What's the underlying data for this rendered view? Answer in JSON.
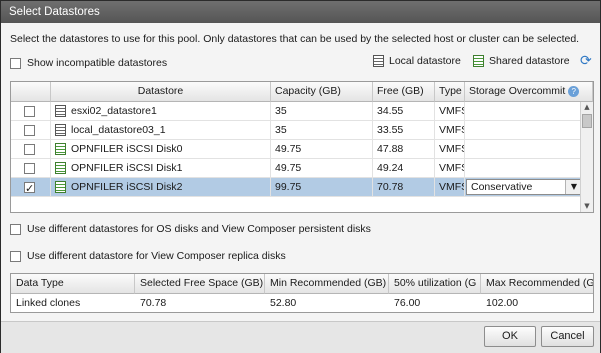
{
  "dialog": {
    "title": "Select Datastores",
    "instructions": "Select the datastores to use for this pool. Only datastores that can be used by the selected host or cluster can be selected.",
    "show_incompatible_label": "Show incompatible datastores",
    "show_incompatible_checked": false,
    "legend_local": "Local datastore",
    "legend_shared": "Shared datastore"
  },
  "grid": {
    "headers": [
      "Datastore",
      "Capacity (GB)",
      "Free (GB)",
      "Type",
      "Storage Overcommit"
    ],
    "rows": [
      {
        "checked": false,
        "icon": "local-datastore-icon",
        "name": "esxi02_datastore1",
        "capacity": "35",
        "free": "34.55",
        "type": "VMFS",
        "overcommit": ""
      },
      {
        "checked": false,
        "icon": "local-datastore-icon",
        "name": "local_datastore03_1",
        "capacity": "35",
        "free": "33.55",
        "type": "VMFS",
        "overcommit": ""
      },
      {
        "checked": false,
        "icon": "shared-datastore-icon",
        "name": "OPNFILER iSCSI Disk0",
        "capacity": "49.75",
        "free": "47.88",
        "type": "VMFS",
        "overcommit": ""
      },
      {
        "checked": false,
        "icon": "shared-datastore-icon",
        "name": "OPNFILER iSCSI Disk1",
        "capacity": "49.75",
        "free": "49.24",
        "type": "VMFS",
        "overcommit": ""
      },
      {
        "checked": true,
        "icon": "shared-datastore-icon",
        "name": "OPNFILER iSCSI Disk2",
        "capacity": "99.75",
        "free": "70.78",
        "type": "VMFS",
        "overcommit": "Conservative"
      }
    ]
  },
  "options": {
    "separate_os_label": "Use different datastores for OS disks and View Composer persistent disks",
    "separate_replica_label": "Use different datastore for View Composer replica disks"
  },
  "summary": {
    "headers": [
      "Data Type",
      "Selected Free Space (GB)",
      "Min Recommended (GB)",
      "50% utilization (G",
      "Max Recommended (GE"
    ],
    "values": [
      "Linked clones",
      "70.78",
      "52.80",
      "76.00",
      "102.00"
    ]
  },
  "buttons": {
    "ok": "OK",
    "cancel": "Cancel"
  }
}
